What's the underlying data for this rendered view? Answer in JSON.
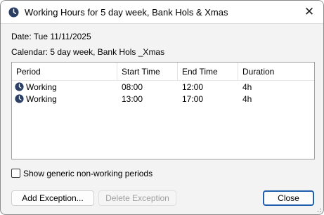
{
  "window": {
    "title": "Working Hours for 5 day week, Bank Hols & Xmas",
    "title_icon": "clock-icon",
    "close_glyph": "✕"
  },
  "info": {
    "date": "Date: Tue 11/11/2025",
    "calendar": "Calendar: 5 day week, Bank Hols _Xmas"
  },
  "table": {
    "columns": [
      "Period",
      "Start Time",
      "End Time",
      "Duration"
    ],
    "rows": [
      {
        "period": "Working",
        "icon": "clock-icon",
        "start": "08:00",
        "end": "12:00",
        "duration": "4h"
      },
      {
        "period": "Working",
        "icon": "clock-icon",
        "start": "13:00",
        "end": "17:00",
        "duration": "4h"
      }
    ]
  },
  "options": {
    "show_generic_label": "Show generic non-working periods",
    "show_generic_checked": false
  },
  "buttons": {
    "add_exception": "Add Exception...",
    "delete_exception": "Delete Exception",
    "delete_enabled": false,
    "close": "Close"
  },
  "colors": {
    "accent": "#1f5fae",
    "clock_icon": "#2b3e63",
    "disabled_text": "#a0a0a0"
  }
}
